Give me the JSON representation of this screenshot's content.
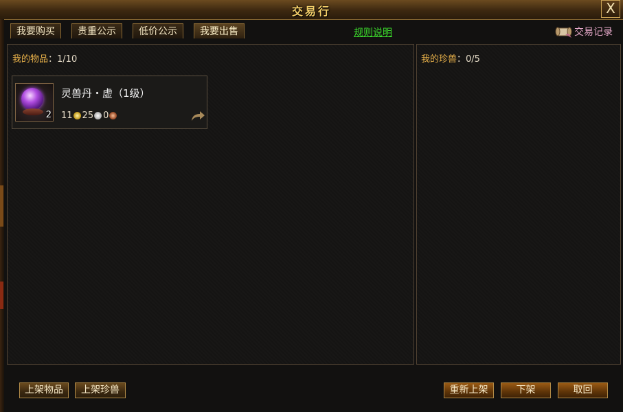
{
  "window": {
    "title": "交易行",
    "close_label": "X"
  },
  "tabs": [
    {
      "label": "我要购买",
      "active": false
    },
    {
      "label": "贵重公示",
      "active": false
    },
    {
      "label": "低价公示",
      "active": false
    },
    {
      "label": "我要出售",
      "active": true
    }
  ],
  "rules_link": "规则说明",
  "history": {
    "label": "交易记录",
    "icon": "scroll-icon"
  },
  "items_panel": {
    "label": "我的物品",
    "count": "：1/10",
    "items": [
      {
        "name": "灵兽丹・虚（1级）",
        "quantity": "2",
        "icon": "purple-orb-icon",
        "price": {
          "gold": "11",
          "silver": "25",
          "copper": "0"
        }
      }
    ]
  },
  "pets_panel": {
    "label": "我的珍兽",
    "count": "：0/5"
  },
  "bottom_buttons": {
    "list_item": "上架物品",
    "list_pet": "上架珍兽",
    "relist": "重新上架",
    "delist": "下架",
    "retrieve": "取回"
  },
  "colors": {
    "accent": "#e8b14a",
    "link": "#3cdc2c",
    "history": "#e3a6c6"
  }
}
